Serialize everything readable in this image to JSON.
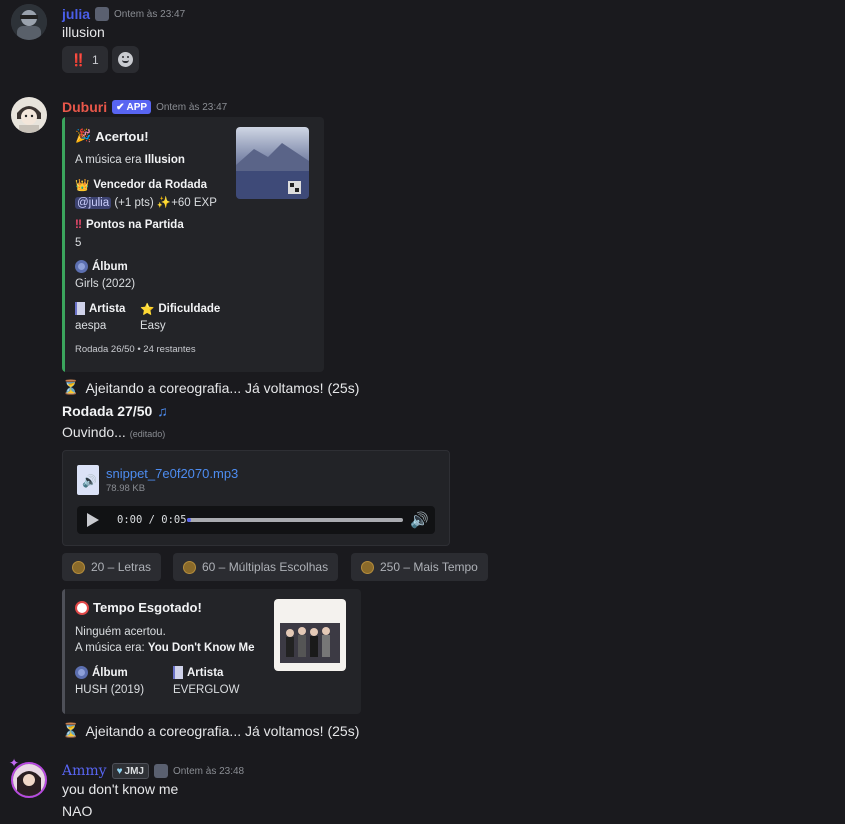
{
  "messages": {
    "julia": {
      "username": "julia",
      "timestamp": "Ontem às 23:47",
      "text": "illusion",
      "reaction": {
        "emoji": "‼️",
        "count": "1"
      }
    },
    "duburi": {
      "username": "Duburi",
      "app_tag": "APP",
      "timestamp": "Ontem às 23:47",
      "embed1": {
        "title": "Acertou!",
        "desc_prefix": "A música era ",
        "desc_song": "Illusion",
        "winner_label": "Vencedor da Rodada",
        "winner_mention": "@julia",
        "winner_pts": "(+1 pts)",
        "winner_exp": "+60 EXP",
        "points_label": "Pontos na Partida",
        "points_value": "5",
        "album_label": "Álbum",
        "album_value": "Girls (2022)",
        "artist_label": "Artista",
        "artist_value": "aespa",
        "difficulty_label": "Dificuldade",
        "difficulty_value": "Easy",
        "footer": "Rodada 26/50 • 24 restantes"
      },
      "wait1": "Ajeitando a coreografia... Já voltamos! (25s)",
      "round_title": "Rodada 27/50",
      "listening": "Ouvindo...",
      "edited": "(editado)",
      "file": {
        "name": "snippet_7e0f2070.mp3",
        "size": "78.98 KB",
        "time": "0:00 / 0:05",
        "progress": 0.02
      },
      "buttons": [
        {
          "label": "20 – Letras"
        },
        {
          "label": "60 – Múltiplas Escolhas"
        },
        {
          "label": "250 – Mais Tempo"
        }
      ],
      "embed2": {
        "title": "Tempo Esgotado!",
        "line1": "Ninguém acertou.",
        "line2_prefix": "A música era: ",
        "line2_song": "You Don't Know Me",
        "album_label": "Álbum",
        "album_value": "HUSH (2019)",
        "artist_label": "Artista",
        "artist_value": "EVERGLOW"
      },
      "wait2": "Ajeitando a coreografia... Já voltamos! (25s)"
    },
    "ammy": {
      "username": "Ammy",
      "guild_tag": "JMJ",
      "timestamp": "Ontem às 23:48",
      "text1": "you don't know me",
      "text2": "NAO"
    }
  },
  "colors": {
    "julia_name": "#4a5ee8",
    "duburi_name": "#e8574a",
    "ammy_name": "#5865f2",
    "success_bar": "#3ba55d",
    "neutral_bar": "#4e5058",
    "link": "#4d8cf0",
    "app_tag": "#5865f2"
  }
}
